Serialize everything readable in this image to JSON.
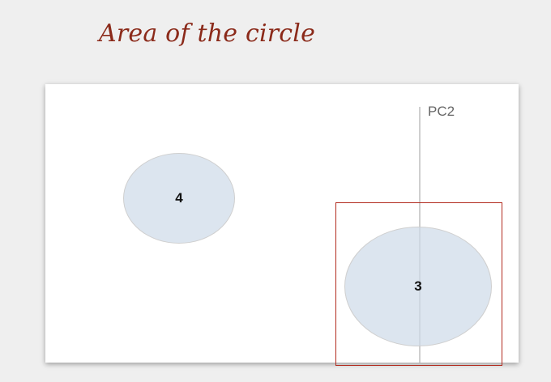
{
  "title": "Area of the circle",
  "axis": {
    "label": "PC2"
  },
  "bubbles": [
    {
      "label": "4"
    },
    {
      "label": "3"
    }
  ],
  "colors": {
    "title": "#8b2a1a",
    "bubble_fill": "#cddae8",
    "highlight": "#b22a1e"
  }
}
